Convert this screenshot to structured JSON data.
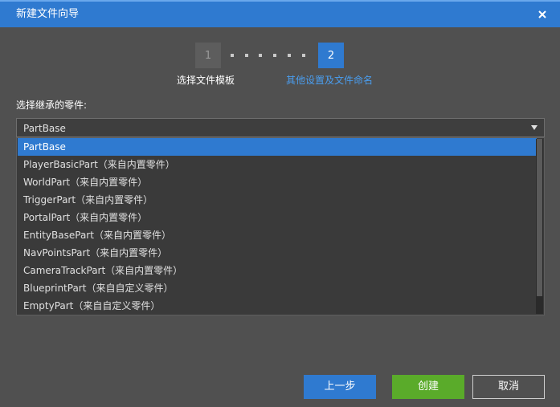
{
  "window": {
    "title": "新建文件向导"
  },
  "stepper": {
    "steps": [
      {
        "number": "1",
        "label": "选择文件模板"
      },
      {
        "number": "2",
        "label": "其他设置及文件命名"
      }
    ]
  },
  "form": {
    "parent_label": "选择继承的零件:",
    "selected_value": "PartBase",
    "options": [
      "PartBase",
      "PlayerBasicPart（来自内置零件）",
      "WorldPart（来自内置零件）",
      "TriggerPart（来自内置零件）",
      "PortalPart（来自内置零件）",
      "EntityBasePart（来自内置零件）",
      "NavPointsPart（来自内置零件）",
      "CameraTrackPart（来自内置零件）",
      "BlueprintPart（来自自定义零件）",
      "EmptyPart（来自自定义零件）"
    ]
  },
  "buttons": {
    "prev_label": "上一步",
    "create_label": "创建",
    "cancel_label": "取消"
  },
  "colors": {
    "accent": "#2f7ad0",
    "create": "#5aab2a",
    "background": "#505050"
  }
}
